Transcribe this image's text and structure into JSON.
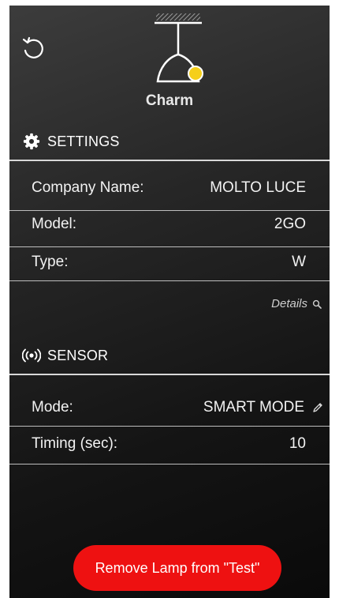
{
  "lamp": {
    "name": "Charm",
    "icon": "pendant-lamp-icon",
    "indicator_color": "#f5cf1a"
  },
  "settings": {
    "title": "SETTINGS",
    "icon": "gear-icon",
    "rows": [
      {
        "label": "Company Name:",
        "value": "MOLTO LUCE"
      },
      {
        "label": "Model:",
        "value": "2GO"
      },
      {
        "label": "Type:",
        "value": "W"
      }
    ],
    "details_link": "Details",
    "details_icon": "search-icon"
  },
  "sensor": {
    "title": "SENSOR",
    "icon": "sensor-icon",
    "rows": [
      {
        "label": "Mode:",
        "value": "SMART MODE",
        "editable": true
      },
      {
        "label": "Timing (sec):",
        "value": "10"
      }
    ]
  },
  "actions": {
    "remove_label": "Remove Lamp from \"Test\"",
    "remove_color": "#ee1111"
  },
  "toolbar": {
    "refresh_icon": "refresh-icon"
  }
}
